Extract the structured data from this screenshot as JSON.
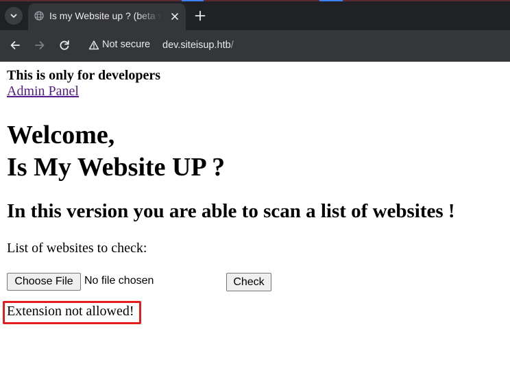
{
  "browser": {
    "tab": {
      "title": "Is my Website up ? (beta version)"
    },
    "address_bar": {
      "security_label": "Not secure",
      "url_host": "dev.siteisup.htb",
      "url_path": "/"
    }
  },
  "page": {
    "developer_note": "This is only for developers",
    "admin_link": "Admin Panel",
    "welcome_line1": "Welcome,",
    "welcome_line2": "Is My Website UP ?",
    "subheading": "In this version you are able to scan a list of websites !",
    "list_label": "List of websites to check:",
    "file_input": {
      "button_label": "Choose File",
      "status": "No file chosen"
    },
    "check_button": "Check",
    "error_message": "Extension not allowed!"
  },
  "colors": {
    "link_visited": "#551a8b",
    "error_highlight": "#e11d1d",
    "chrome_dark": "#202124",
    "toolbar": "#35363a"
  }
}
